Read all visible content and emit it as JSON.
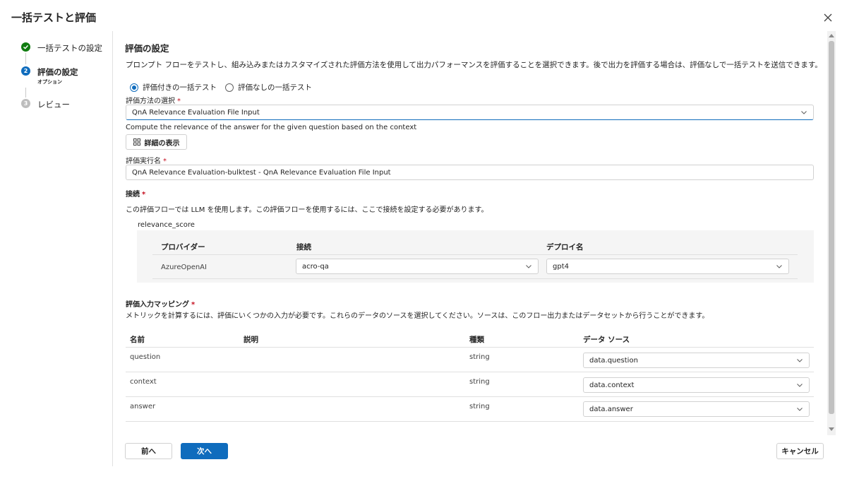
{
  "dialog": {
    "title": "一括テストと評価"
  },
  "steps": [
    {
      "label": "一括テストの設定",
      "status": "completed"
    },
    {
      "label": "評価の設定",
      "sub": "オプション",
      "status": "current",
      "number": "2"
    },
    {
      "label": "レビュー",
      "status": "pending",
      "number": "3"
    }
  ],
  "section": {
    "title": "評価の設定",
    "description": "プロンプト フローをテストし、組み込みまたはカスタマイズされた評価方法を使用して出力パフォーマンスを評価することを選択できます。後で出力を評価する場合は、評価なしで一括テストを送信できます。"
  },
  "radio": {
    "with_eval": "評価付きの一括テスト",
    "without_eval": "評価なしの一括テスト",
    "selected": "with_eval"
  },
  "method": {
    "label": "評価方法の選択",
    "value": "QnA Relevance Evaluation File Input",
    "description": "Compute the relevance of the answer for the given question based on the context",
    "details_button": "詳細の表示"
  },
  "run_name": {
    "label": "評価実行名",
    "value": "QnA Relevance Evaluation-bulktest - QnA Relevance Evaluation File Input"
  },
  "connection": {
    "label": "接続",
    "description": "この評価フローでは LLM を使用します。この評価フローを使用するには、ここで接続を設定する必要があります。",
    "node_name": "relevance_score",
    "headers": {
      "provider": "プロバイダー",
      "connection": "接続",
      "deployment": "デプロイ名"
    },
    "row": {
      "provider": "AzureOpenAI",
      "connection": "acro-qa",
      "deployment": "gpt4"
    }
  },
  "mapping": {
    "label": "評価入力マッピング",
    "description": "メトリックを計算するには、評価にいくつかの入力が必要です。これらのデータのソースを選択してください。ソースは、このフロー出力またはデータセットから行うことができます。",
    "headers": {
      "name": "名前",
      "description": "説明",
      "type": "種類",
      "source": "データ ソース"
    },
    "rows": [
      {
        "name": "question",
        "type": "string",
        "source": "data.question"
      },
      {
        "name": "context",
        "type": "string",
        "source": "data.context"
      },
      {
        "name": "answer",
        "type": "string",
        "source": "data.answer"
      }
    ]
  },
  "footer": {
    "prev": "前へ",
    "next": "次へ",
    "cancel": "キャンセル"
  },
  "colors": {
    "accent": "#0f6cbd",
    "success": "#107c10",
    "required": "#c50f1f"
  }
}
